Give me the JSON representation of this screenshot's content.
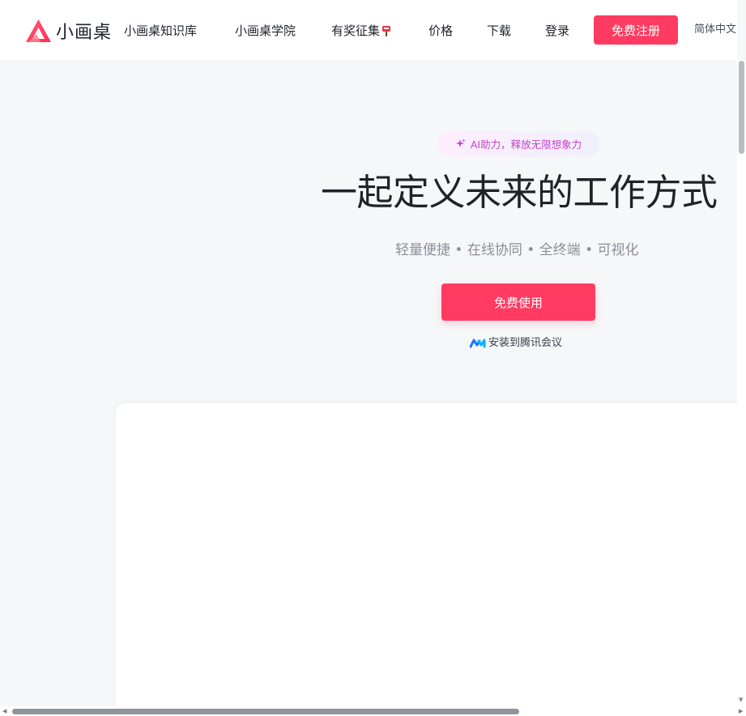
{
  "header": {
    "logo_text": "小画桌",
    "nav": [
      {
        "label": "小画桌知识库"
      },
      {
        "label": "小画桌学院"
      },
      {
        "label": "有奖征集"
      },
      {
        "label": "价格"
      },
      {
        "label": "下载"
      },
      {
        "label": "登录"
      }
    ],
    "signup_label": "免费注册",
    "language": "简体中文"
  },
  "hero": {
    "badge": "AI助力，释放无限想象力",
    "title": "一起定义未来的工作方式",
    "subtitle": "轻量便捷 • 在线协同 • 全终端 • 可视化",
    "cta_label": "免费使用",
    "install_label": "安装到腾讯会议"
  },
  "colors": {
    "brand": "#ff3b61",
    "badge_text": "#c643c9",
    "meeting_blue": "#1677ff"
  },
  "icons": {
    "logo": "xiaohuazhuo-triangle-logo",
    "badge": "sparkle-icon",
    "nav_emoji": "postbox-icon",
    "install": "tencent-meeting-icon",
    "language": "chevron-down-icon"
  }
}
